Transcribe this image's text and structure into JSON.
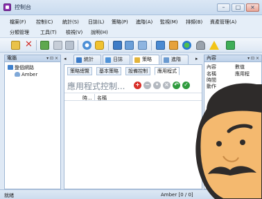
{
  "window": {
    "title": "控制台"
  },
  "window_controls": {
    "minimize": "–",
    "maximize": "□",
    "close": "×"
  },
  "menu": {
    "row1": [
      "檔案(F)",
      "控制(C)",
      "統計(S)",
      "日誌(L)",
      "策略(P)",
      "進階(A)",
      "監視(M)",
      "排頻(B)",
      "資產管理(A)"
    ],
    "row2": [
      "分類管理",
      "工具(T)",
      "檢視(V)",
      "說明(H)"
    ]
  },
  "left_panel": {
    "header": "電腦",
    "header_controls": "▾ ⊡ ×",
    "tree": [
      {
        "label": "整個網路",
        "icon_name": "network-icon"
      },
      {
        "label": "Amber",
        "icon_name": "user-group-icon"
      }
    ]
  },
  "center_panel": {
    "tabs": [
      {
        "label": "統計"
      },
      {
        "label": "日誌"
      },
      {
        "label": "策略"
      },
      {
        "label": "進階"
      }
    ],
    "tab_scroll_left": "◂",
    "tab_scroll_right": "▸",
    "subtabs": [
      "策略總覽",
      "基本策略",
      "設備控制",
      "應用程式"
    ],
    "active_subtab": "應用程式",
    "section_title": "應用程式控制...",
    "columns": [
      "時...",
      "名稱"
    ]
  },
  "right_panel": {
    "header": "內容",
    "header_controls": "▾ ⊡ ×",
    "col_headers": [
      "內容",
      "數值"
    ],
    "rows": [
      {
        "name": "名稱",
        "value": "應用程"
      },
      {
        "name": "時間",
        "value": ""
      },
      {
        "name": "動作",
        "value": ""
      }
    ]
  },
  "status": {
    "left": "就緒",
    "right": "Amber [0 / 0]"
  },
  "colors": {
    "accent": "#8a2fae",
    "skin": "#f4b96f",
    "hair": "#2e2b2a"
  }
}
